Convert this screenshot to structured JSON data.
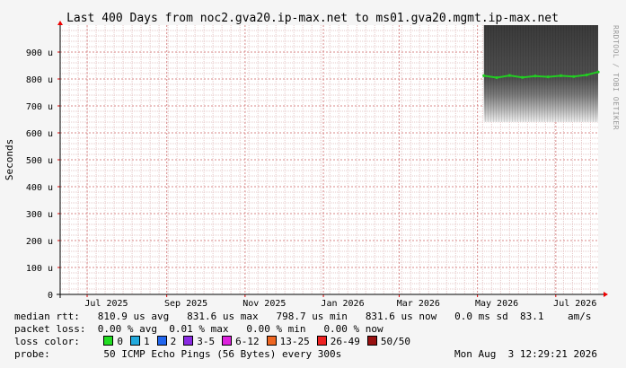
{
  "watermark": "RRDTOOL / TOBI OETIKER",
  "colors": {
    "background": "#f5f5f5",
    "plot_bg": "#ffffff",
    "grid_minor": "#e6c8c8",
    "grid_major": "#d88a8a",
    "smoke_dark": "#3a3a3a",
    "median_line": "#22cc22"
  },
  "chart_data": {
    "type": "area",
    "title": "Last 400 Days from noc2.gva20.ip-max.net to ms01.gva20.mgmt.ip-max.net",
    "ylabel": "Seconds",
    "xlabel": "",
    "x_ticks": [
      "Jul 2025",
      "Sep 2025",
      "Nov 2025",
      "Jan 2026",
      "Mar 2026",
      "May 2026",
      "Jul 2026"
    ],
    "y_ticks": [
      {
        "value": 0,
        "label": "0"
      },
      {
        "value": 100,
        "label": "100 u"
      },
      {
        "value": 200,
        "label": "200 u"
      },
      {
        "value": 300,
        "label": "300 u"
      },
      {
        "value": 400,
        "label": "400 u"
      },
      {
        "value": 500,
        "label": "500 u"
      },
      {
        "value": 600,
        "label": "600 u"
      },
      {
        "value": 700,
        "label": "700 u"
      },
      {
        "value": 800,
        "label": "800 u"
      },
      {
        "value": 900,
        "label": "900 u"
      }
    ],
    "ylim": [
      0,
      1000
    ],
    "x_range": [
      "2025-06-10",
      "2026-08-03"
    ],
    "grid": true,
    "series": [
      {
        "name": "median rtt",
        "color": "#22cc22",
        "x": [
          "2026-05-06",
          "2026-05-16",
          "2026-05-26",
          "2026-06-05",
          "2026-06-15",
          "2026-06-25",
          "2026-07-05",
          "2026-07-15",
          "2026-07-25",
          "2026-08-03"
        ],
        "y": [
          812,
          805,
          813,
          806,
          811,
          808,
          812,
          809,
          815,
          826
        ]
      }
    ],
    "smoke_band": {
      "x_start": "2026-05-06",
      "x_end": "2026-08-03",
      "y_top": 1000,
      "y_bottom": 640
    }
  },
  "legend": {
    "median": {
      "label": "median rtt:",
      "avg": "810.9 us avg",
      "max": "831.6 us max",
      "min": "798.7 us min",
      "now": "831.6 us now",
      "sd": "0.0 ms sd",
      "am": "83.1",
      "am_unit": "am/s"
    },
    "loss": {
      "label": "packet loss:",
      "avg": "0.00 % avg",
      "max": "0.01 % max",
      "min": "0.00 % min",
      "now": "0.00 % now"
    },
    "loss_color": {
      "label": "loss color:",
      "items": [
        {
          "label": "0",
          "color": "#22dd22"
        },
        {
          "label": "1",
          "color": "#22aadd"
        },
        {
          "label": "2",
          "color": "#2266ee"
        },
        {
          "label": "3-5",
          "color": "#8a2be2"
        },
        {
          "label": "6-12",
          "color": "#dd22dd"
        },
        {
          "label": "13-25",
          "color": "#ee6622"
        },
        {
          "label": "26-49",
          "color": "#ee2222"
        },
        {
          "label": "50/50",
          "color": "#991111"
        }
      ]
    },
    "probe": {
      "label": "probe:",
      "text": "50 ICMP Echo Pings (56 Bytes) every 300s",
      "timestamp": "Mon Aug  3 12:29:21 2026"
    }
  }
}
